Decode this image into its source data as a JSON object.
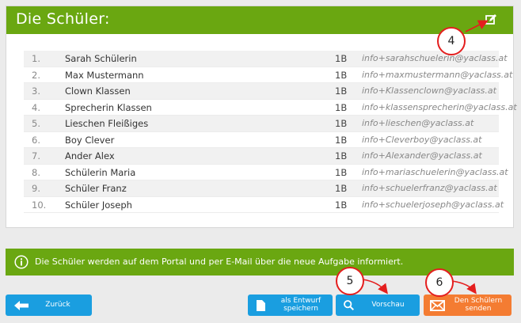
{
  "panel": {
    "title": "Die Schüler:",
    "edit_icon": "edit-icon"
  },
  "students": [
    {
      "num": "1.",
      "name": "Sarah Schülerin",
      "class": "1B",
      "email": "info+sarahschuelerin@yaclass.at"
    },
    {
      "num": "2.",
      "name": "Max Mustermann",
      "class": "1B",
      "email": "info+maxmustermann@yaclass.at"
    },
    {
      "num": "3.",
      "name": "Clown Klassen",
      "class": "1B",
      "email": "info+Klassenclown@yaclass.at"
    },
    {
      "num": "4.",
      "name": "Sprecherin Klassen",
      "class": "1B",
      "email": "info+klassensprecherin@yaclass.at"
    },
    {
      "num": "5.",
      "name": "Lieschen Fleißiges",
      "class": "1B",
      "email": "info+lieschen@yaclass.at"
    },
    {
      "num": "6.",
      "name": "Boy Clever",
      "class": "1B",
      "email": "info+Cleverboy@yaclass.at"
    },
    {
      "num": "7.",
      "name": "Ander Alex",
      "class": "1B",
      "email": "info+Alexander@yaclass.at"
    },
    {
      "num": "8.",
      "name": "Schülerin Maria",
      "class": "1B",
      "email": "info+mariaschuelerin@yaclass.at"
    },
    {
      "num": "9.",
      "name": "Schüler Franz",
      "class": "1B",
      "email": "info+schuelerfranz@yaclass.at"
    },
    {
      "num": "10.",
      "name": "Schüler Joseph",
      "class": "1B",
      "email": "info+schuelerjoseph@yaclass.at"
    }
  ],
  "info": {
    "text": "Die Schüler werden auf dem Portal und per E-Mail über die neue Aufgabe informiert."
  },
  "buttons": {
    "back": "Zurück",
    "draft_line1": "als Entwurf",
    "draft_line2": "speichern",
    "preview": "Vorschau",
    "send_line1": "Den Schülern",
    "send_line2": "senden"
  },
  "callouts": {
    "c4": "4",
    "c5": "5",
    "c6": "6"
  },
  "colors": {
    "accent_green": "#6aa711",
    "button_blue": "#1a9ee0",
    "button_orange": "#f47c32",
    "callout_red": "#e41e1e"
  }
}
